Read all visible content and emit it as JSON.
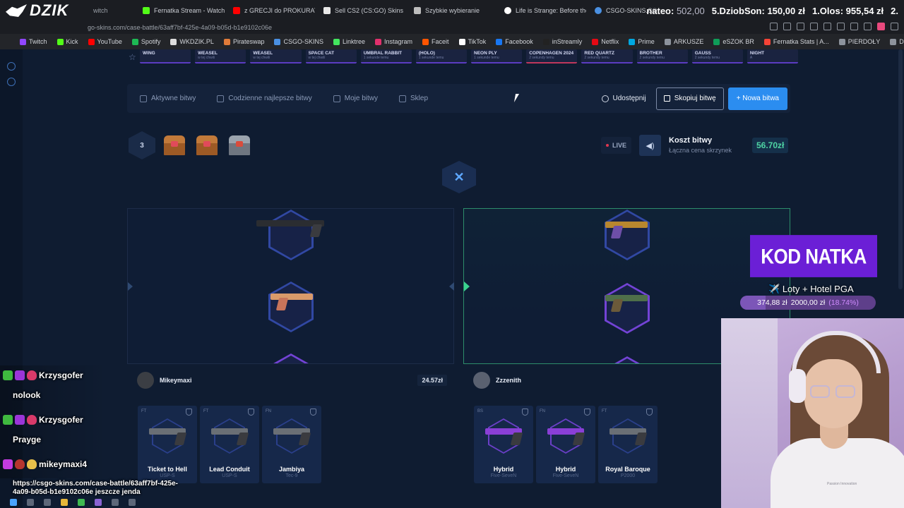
{
  "browser": {
    "tabs": [
      {
        "label": "witch",
        "color": "#9146ff"
      },
      {
        "label": "Fernatka Stream - Watch",
        "color": "#53fc18"
      },
      {
        "label": "z GRECJI do PROKURATU",
        "color": "#ff0000"
      },
      {
        "label": "Sell CS2 (CS:GO) Skins |",
        "color": "#e8e8e8"
      },
      {
        "label": "Szybkie wybieranie",
        "color": "#bdbdbd"
      },
      {
        "label": "Life is Strange: Before the",
        "color": "#ffffff"
      },
      {
        "label": "CSGO-SKINS.CO",
        "color": "#4a90e2"
      }
    ],
    "leaderboard": [
      {
        "name": "nateo:",
        "amount": "502,00"
      },
      {
        "name": "5.DziobSon:",
        "amount": "150,00 zł"
      },
      {
        "name": "1.Olos:",
        "amount": "955,54 zł"
      },
      {
        "name": "2.",
        "amount": ""
      }
    ],
    "url": "go-skins.com/case-battle/63aff7bf-425e-4a09-b05d-b1e9102c06e",
    "bookmarks": [
      {
        "label": "Twitch",
        "color": "#9146ff"
      },
      {
        "label": "Kick",
        "color": "#53fc18"
      },
      {
        "label": "YouTube",
        "color": "#ff0000"
      },
      {
        "label": "Spotify",
        "color": "#1db954"
      },
      {
        "label": "WKDZIK.PL",
        "color": "#dddddd"
      },
      {
        "label": "Pirateswap",
        "color": "#e07b39"
      },
      {
        "label": "CSGO-SKINS",
        "color": "#4a90e2"
      },
      {
        "label": "Linktree",
        "color": "#43e55e"
      },
      {
        "label": "Instagram",
        "color": "#e1306c"
      },
      {
        "label": "Faceit",
        "color": "#ff5500"
      },
      {
        "label": "TikTok",
        "color": "#ffffff"
      },
      {
        "label": "Facebook",
        "color": "#1877f2"
      },
      {
        "label": "inStreamly",
        "color": "#222222"
      },
      {
        "label": "Netflix",
        "color": "#e50914"
      },
      {
        "label": "Prime",
        "color": "#00a8e1"
      },
      {
        "label": "ARKUSZE",
        "color": "#8d939c"
      },
      {
        "label": "eSZOK BR",
        "color": "#0f9d58"
      },
      {
        "label": "Fernatka Stats | A...",
        "color": "#f44336"
      },
      {
        "label": "PIERDOŁY",
        "color": "#8d939c"
      },
      {
        "label": "DOMKI",
        "color": "#8d939c"
      }
    ]
  },
  "live_drops": [
    {
      "name": "WING",
      "sub": "",
      "accent": "violet"
    },
    {
      "name": "WEASEL",
      "sub": "w tej chwili",
      "accent": "violet"
    },
    {
      "name": "WEASEL",
      "sub": "w tej chwili",
      "accent": "violet"
    },
    {
      "name": "SPACE CAT",
      "sub": "w tej chwili",
      "accent": "violet"
    },
    {
      "name": "UMBRAL RABBIT",
      "sub": "1 sekunde temu",
      "accent": "violet"
    },
    {
      "name": "(HOLO)",
      "sub": "1 sekunde temu",
      "accent": "violet"
    },
    {
      "name": "NEON PLY",
      "sub": "1 sekunde temu",
      "accent": "violet"
    },
    {
      "name": "COPENHAGEN 2024",
      "sub": "2 sekundy temu",
      "accent": "red"
    },
    {
      "name": "RED QUARTZ",
      "sub": "2 sekundy temu",
      "accent": "violet"
    },
    {
      "name": "BROTHER",
      "sub": "2 sekundy temu",
      "accent": "violet"
    },
    {
      "name": "GAUSS",
      "sub": "2 sekundy temu",
      "accent": "violet"
    },
    {
      "name": "NIGHT",
      "sub": "A",
      "accent": "violet"
    }
  ],
  "nav": {
    "active_battles": "Aktywne bitwy",
    "daily_best": "Codzienne najlepsze bitwy",
    "my_battles": "Moje bitwy",
    "shop": "Sklep",
    "share": "Udostępnij",
    "copy": "Skopiuj bitwę",
    "new_battle": "+ Nowa bitwa"
  },
  "battle": {
    "round": "3",
    "live": "LIVE",
    "cost_title": "Koszt bitwy",
    "cost_sub": "Łączna cena skrzynek",
    "cost_value": "56.70zł"
  },
  "players": [
    {
      "name": "Mikeymaxi",
      "value": "24.57zł",
      "items": [
        {
          "wear": "FT",
          "name": "Ticket to Hell",
          "type": "USP-S",
          "hex": "blue"
        },
        {
          "wear": "FT",
          "name": "Lead Conduit",
          "type": "USP-S",
          "hex": "blue"
        },
        {
          "wear": "FN",
          "name": "Jambiya",
          "type": "Tec-9",
          "hex": "blue"
        }
      ]
    },
    {
      "name": "Zzzenith",
      "value": "",
      "items": [
        {
          "wear": "BS",
          "name": "Hybrid",
          "type": "Five-SeveN",
          "hex": "purple"
        },
        {
          "wear": "FN",
          "name": "Hybrid",
          "type": "Five-SeveN",
          "hex": "purple"
        },
        {
          "wear": "FT",
          "name": "Royal Baroque",
          "type": "P2000",
          "hex": "blue"
        }
      ]
    }
  ],
  "chat": [
    {
      "user": "Krzysgofer",
      "message": "nolook"
    },
    {
      "user": "Krzysgofer",
      "message": "Prayge"
    },
    {
      "user": "mikeymaxi4",
      "message": "https://csgo-skins.com/case-battle/63aff7bf-425e-4a09-b05d-b1e9102c06e jeszcze jenda"
    }
  ],
  "overlay": {
    "code_banner": "KOD NATKA",
    "goal_title": "Loty + Hotel PGA",
    "goal_current": "374,88 zł",
    "goal_target": "2000,00 zł",
    "goal_percent": "(18.74%)",
    "goal_fraction": 0.1874,
    "shirt_text": "Passion Innovation"
  }
}
